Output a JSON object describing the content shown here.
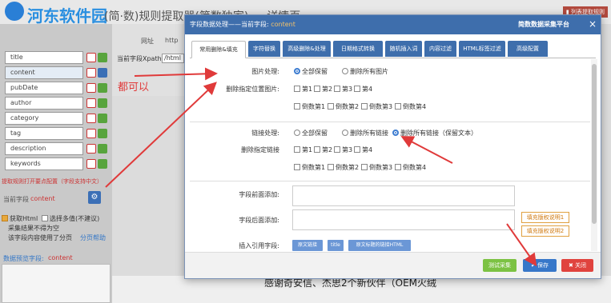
{
  "background": {
    "app_title": "(简·数)规则提取器(简数独家) — 详情页",
    "logo_text": "河东软件园",
    "corner_badge": "▮ 列表提取规则",
    "fields": [
      "title",
      "content",
      "pubDate",
      "author",
      "category",
      "tag",
      "description",
      "keywords"
    ],
    "page_url_label": "网址",
    "page_url_short": "http",
    "xpath_label": "当前字段Xpath",
    "xpath_value": "/html",
    "save_config_note": "提取规则打开要点配置（字段支持中文）",
    "current_field_label": "当前字段",
    "current_field_value": "content",
    "opt_html": "获取Html",
    "opt_multi": "选择多值(不建议)",
    "opt_empty": "采集结果不得为空",
    "opt_paging": "该字段内容使用了分页",
    "help_link": "分页帮助",
    "preview_label": "数据预览",
    "preview_field_label": "字段:",
    "preview_field": "content",
    "bottom_news": "感谢奇安信、杰思2个新伙伴（OEM火绒",
    "annotation": "都可以"
  },
  "modal": {
    "title_prefix": "字段数据处理——当前字段:",
    "title_field": "content",
    "platform": "简数数据采集平台",
    "close": "×",
    "tabs": [
      "常用删除&填充",
      "字符替换",
      "高级删除&处理",
      "日期格式转换",
      "随机插入词",
      "内容过滤",
      "HTML标签过滤",
      "高级配置"
    ],
    "image": {
      "label": "图片处理:",
      "opt_keep": "全部保留",
      "opt_delete": "删除所有图片",
      "pos_label": "删除指定位置图片:",
      "forward": [
        "第1",
        "第2",
        "第3",
        "第4"
      ],
      "backward": [
        "倒数第1",
        "倒数第2",
        "倒数第3",
        "倒数第4"
      ]
    },
    "link": {
      "label": "链接处理:",
      "opt_keep": "全部保留",
      "opt_delete": "删除所有链接",
      "opt_delete_keep_text": "删除所有链接（保留文本）",
      "pos_label": "删除指定链接",
      "forward": [
        "第1",
        "第2",
        "第3",
        "第4"
      ],
      "backward": [
        "倒数第1",
        "倒数第2",
        "倒数第3",
        "倒数第4"
      ]
    },
    "prefix_label": "字段前面添加:",
    "suffix_label": "字段后面添加:",
    "fill_btn_1": "填充版权说明1",
    "fill_btn_2": "填充版权说明2",
    "insert_label": "插入引用字段:",
    "insert_btns": [
      "原文链接",
      "title",
      "原文标题的链接HTML"
    ],
    "btn_test": "测试采集",
    "btn_save": "保存",
    "btn_close": "关闭"
  },
  "colors": {
    "primary": "#3e6eac",
    "green": "#7cc243",
    "save": "#3777c9",
    "danger": "#e0433e",
    "arrow": "#e03a3a"
  }
}
